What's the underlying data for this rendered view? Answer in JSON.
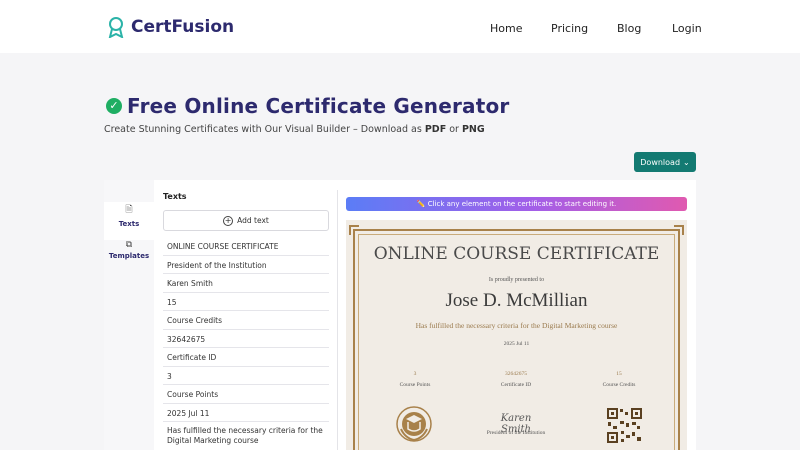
{
  "header": {
    "brand": "CertFusion",
    "nav": [
      "Home",
      "Pricing",
      "Blog",
      "Login"
    ]
  },
  "hero": {
    "title": "Free Online Certificate Generator",
    "subtitle_prefix": "Create Stunning Certificates with Our Visual Builder – Download as ",
    "subtitle_pdf": "PDF",
    "subtitle_or": " or ",
    "subtitle_png": "PNG"
  },
  "toolbar": {
    "download_label": "Download"
  },
  "sidebar": {
    "items": [
      {
        "label": "Texts",
        "icon": "document-icon"
      },
      {
        "label": "Templates",
        "icon": "templates-icon"
      }
    ]
  },
  "texts_panel": {
    "heading": "Texts",
    "add_label": "Add text",
    "items": [
      "ONLINE COURSE CERTIFICATE",
      "President of the Institution",
      "Karen Smith",
      "15",
      "Course Credits",
      "32642675",
      "Certificate ID",
      "3",
      "Course Points",
      "2025 Jul 11",
      "Has fulfilled the necessary criteria for the Digital Marketing course"
    ]
  },
  "preview": {
    "hint": "✏️ Click any element on the certificate to start editing it."
  },
  "certificate": {
    "title": "ONLINE COURSE CERTIFICATE",
    "presented": "Is proudly presented to",
    "name": "Jose D. McMillian",
    "description": "Has fulfilled the necessary criteria for the Digital Marketing course",
    "date": "2025 Jul 11",
    "stats": [
      {
        "value": "3",
        "label": "Course Points"
      },
      {
        "value": "32642675",
        "label": "Certificate ID"
      },
      {
        "value": "15",
        "label": "Course Credits"
      }
    ],
    "signature": "Karen Smith",
    "signature_title": "President of the Institution"
  },
  "colors": {
    "brand": "#2d2a6e",
    "download": "#137a72",
    "check": "#1fae63",
    "gold": "#a8814a"
  }
}
